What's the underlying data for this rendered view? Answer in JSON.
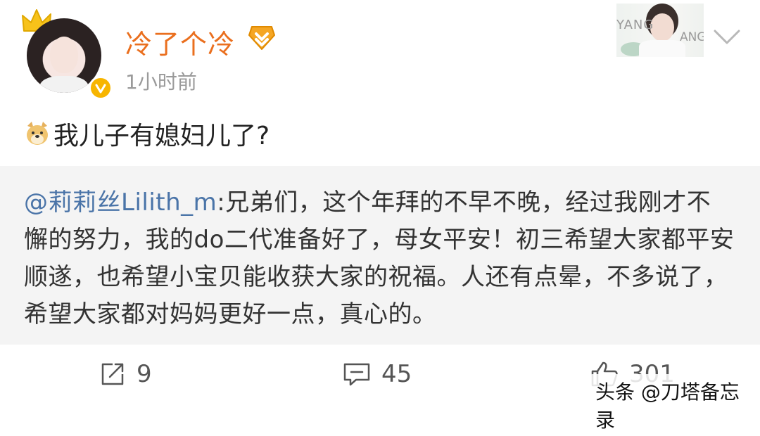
{
  "post": {
    "username": "冷了个冷",
    "timestamp": "1小时前",
    "text": "我儿子有媳妇儿了?"
  },
  "repost": {
    "mention": "@莉莉丝Lilith_m",
    "body": ":兄弟们，这个年拜的不早不晚，经过我刚才不懈的努力，我的do二代准备好了，母女平安！初三希望大家都平安顺遂，也希望小宝贝能收获大家的祝福。人还有点晕，不多说了，希望大家都对妈妈更好一点，真心的。"
  },
  "card": {
    "label_left": "YANG",
    "label_right": "ANG"
  },
  "actions": {
    "repost_count": "9",
    "comment_count": "45",
    "like_count": "301"
  },
  "watermark": "头条 @刀塔备忘录",
  "colors": {
    "username": "#ea6f1e",
    "mention": "#4a74a8",
    "verified": "#f7b500",
    "repost_bg": "#f4f4f4"
  },
  "icons": [
    "crown-icon",
    "verified-icon",
    "rank-badge-icon",
    "doge-emoji-icon",
    "chevron-down-icon",
    "repost-icon",
    "comment-icon",
    "like-icon"
  ]
}
